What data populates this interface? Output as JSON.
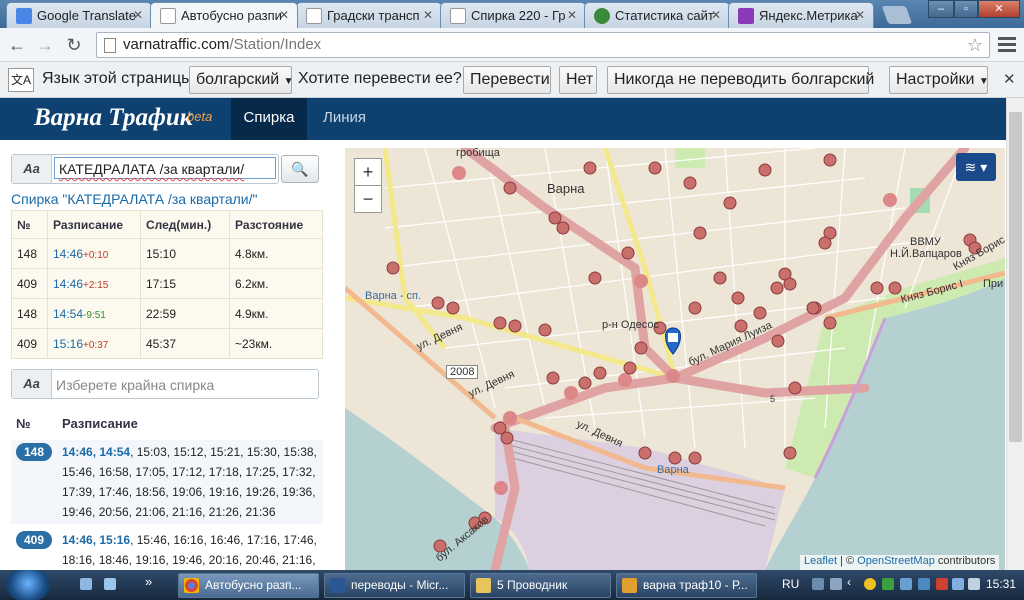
{
  "browser": {
    "tabs": [
      {
        "label": "Google Translate"
      },
      {
        "label": "Автобусно разпи"
      },
      {
        "label": "Градски трансп"
      },
      {
        "label": "Спирка 220 - Гр"
      },
      {
        "label": "Статистика сайт"
      },
      {
        "label": "Яндекс.Метрика"
      }
    ],
    "url_domain": "varnatraffic.com",
    "url_path": "/Station/Index"
  },
  "translate_bar": {
    "text1": "Язык этой страницы",
    "language": "болгарский",
    "text2": "Хотите перевести ее?",
    "translate_btn": "Перевести",
    "no_btn": "Нет",
    "never_btn": "Никогда не переводить болгарский",
    "settings_btn": "Настройки"
  },
  "site": {
    "logo": "Варна Трафик",
    "beta": "beta",
    "nav_station": "Спирка",
    "nav_line": "Линия"
  },
  "station_search": {
    "aa": "Aa",
    "value": "КАТЕДРАЛАТА /за квартали/"
  },
  "station_title": "Спирка \"КАТЕДРАЛАТА /за квартали/\"",
  "schedule": {
    "headers": [
      "№",
      "Разписание",
      "След(мин.)",
      "Разстояние"
    ],
    "rows": [
      {
        "line": "148",
        "time": "14:46",
        "delay": "+0:10",
        "next": "15:10",
        "dist": "4.8км."
      },
      {
        "line": "409",
        "time": "14:46",
        "delay": "+2:15",
        "next": "17:15",
        "dist": "6.2км."
      },
      {
        "line": "148",
        "time": "14:54",
        "delay": "-9:51",
        "next": "22:59",
        "dist": "4.9км."
      },
      {
        "line": "409",
        "time": "15:16",
        "delay": "+0:37",
        "next": "45:37",
        "dist": "~23км."
      }
    ]
  },
  "end_search": {
    "aa": "Aa",
    "placeholder": "Изберете крайна спирка"
  },
  "timetable": {
    "h_no": "№",
    "h_schedule": "Разписание",
    "lines": [
      {
        "line": "148",
        "bold": "14:46, 14:54",
        "rest1": ", 15:03, 15:12, 15:21, 15:30, 15:38,",
        "row2": "15:46, 16:58, 17:05, 17:12, 17:18, 17:25, 17:32,",
        "row3": "17:39, 17:46, 18:56, 19:06, 19:16, 19:26, 19:36,",
        "row4": "19:46, 20:56, 21:06, 21:16, 21:26, 21:36"
      },
      {
        "line": "409",
        "bold": "14:46, 15:16",
        "rest1": ", 15:46, 16:16, 16:46, 17:16, 17:46,",
        "row2": "18:16, 18:46, 19:16, 19:46, 20:16, 20:46, 21:16,"
      }
    ]
  },
  "map": {
    "zoom_in": "+",
    "zoom_out": "−",
    "labels": {
      "varna": "Варна",
      "grobishta": "гробища",
      "varna_zap": "Варна - сп.",
      "odesos": "р-н Одесос",
      "vvmu": "ВВМУ",
      "vaptsarov": "Н.Й.Вапцаров",
      "knyaz": "Княз Борис I",
      "knyaz2": "Княз Борис I",
      "mlui": "бул. Мария Луиза",
      "devnya1": "ул. Девня",
      "devnya2": "ул. Девня",
      "devnya3": "ул. Девня",
      "road2008": "2008",
      "aksakov": "бул. Аксаков",
      "varna_station": "Варна",
      "pri": "При",
      "five": "5"
    },
    "attribution_leaflet": "Leaflet",
    "attribution_sep": " | © ",
    "attribution_osm": "OpenStreetMap",
    "attribution_rest": " contributors"
  },
  "taskbar": {
    "tasks": [
      {
        "label": "Автобусно разп..."
      },
      {
        "label": "переводы - Micr..."
      },
      {
        "label": "5 Проводник"
      },
      {
        "label": "варна траф10 - Р..."
      }
    ],
    "lang": "RU",
    "clock": "15:31"
  },
  "colors": {
    "header": "#0f4170",
    "link": "#1a6aa8",
    "road_main": "#e0a3a3",
    "sea": "#b5d0d0"
  }
}
